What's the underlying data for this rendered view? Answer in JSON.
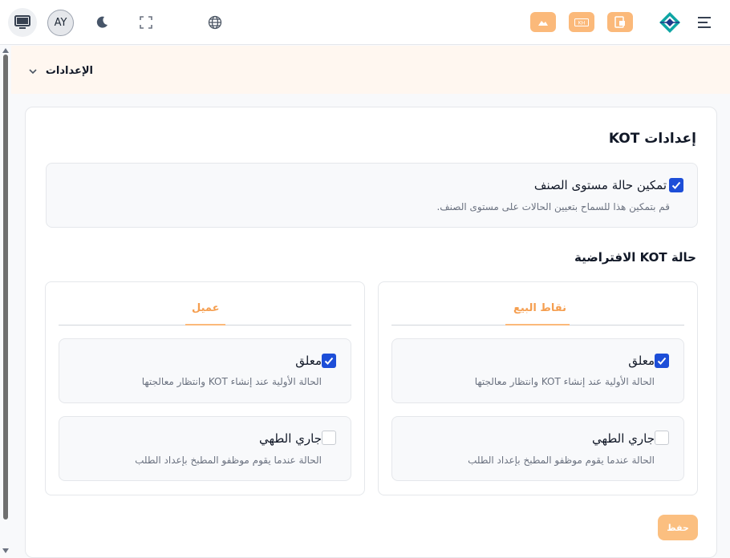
{
  "header": {
    "avatar_initials": "AY",
    "icons": [
      "monitor-icon",
      "moon-icon",
      "fullscreen-icon",
      "globe-icon",
      "cloud-icon",
      "khr-icon",
      "document-icon",
      "logo-icon",
      "menu-icon"
    ],
    "orange_icon_label": "KH"
  },
  "breadcrumb": {
    "label": "الإعدادات"
  },
  "kot_settings": {
    "title": "إعدادات KOT",
    "item_status": {
      "label": "تمكين حالة مستوى الصنف",
      "description": "قم بتمكين هذا للسماح بتعيين الحالات على مستوى الصنف.",
      "checked": true
    }
  },
  "default_status": {
    "title": "حالة KOT الافتراضية",
    "panels": [
      {
        "tab": "نقاط البيع",
        "options": [
          {
            "label": "معلق",
            "description": "الحالة الأولية عند إنشاء KOT وانتظار معالجتها",
            "checked": true
          },
          {
            "label": "جاري الطهي",
            "description": "الحالة عندما يقوم موظفو المطبخ بإعداد الطلب",
            "checked": false
          }
        ]
      },
      {
        "tab": "عميل",
        "options": [
          {
            "label": "معلق",
            "description": "الحالة الأولية عند إنشاء KOT وانتظار معالجتها",
            "checked": true
          },
          {
            "label": "جاري الطهي",
            "description": "الحالة عندما يقوم موظفو المطبخ بإعداد الطلب",
            "checked": false
          }
        ]
      }
    ]
  },
  "actions": {
    "save_label": "حفظ"
  },
  "colors": {
    "accent": "#fbb97a",
    "checkbox": "#1d4ed8",
    "tab_text": "#f59e4f"
  }
}
